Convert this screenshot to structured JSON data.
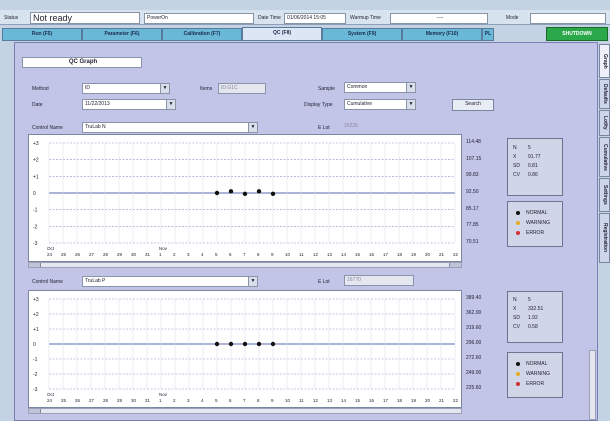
{
  "status_bar": {
    "status_label": "Status",
    "status_value": "Not ready",
    "power_label": "PowerOn",
    "datetime_label": "Date Time",
    "datetime_value": "01/06/2014 15:05",
    "warmup_label": "Warmup Time",
    "warmup_value": "----",
    "mode_label": "Mode",
    "mode_value": ""
  },
  "tabs": [
    {
      "label": "Run (F5)"
    },
    {
      "label": "Parameter (F6)"
    },
    {
      "label": "Calibration (F7)"
    },
    {
      "label": "QC (F8)"
    },
    {
      "label": "System (F9)"
    },
    {
      "label": "Memory (F10)"
    },
    {
      "label": "PL"
    }
  ],
  "shutdown_label": "SHUTDOWN",
  "panel": {
    "title": "QC Graph",
    "method_label": "Method",
    "method_value": "ID",
    "items_label": "Items",
    "items_value": "ID:G1C",
    "date_label": "Date",
    "date_value": "11/22/2013",
    "sample_label": "Sample",
    "sample_value": "Common",
    "display_type_label": "Display Type",
    "display_type_value": "Cumulative",
    "search_label": "Search",
    "control_name_label": "Control Name",
    "control_name_1": "TruLab N",
    "lot_label": "E Lot",
    "lot_value_1": "16225",
    "control_name_2": "TruLab P",
    "lot_value_2": "16770"
  },
  "side_tabs": [
    {
      "label": "Graph"
    },
    {
      "label": "Defaults"
    },
    {
      "label": "Lot/ty"
    },
    {
      "label": "Cumulative"
    },
    {
      "label": "Settings"
    },
    {
      "label": "Registration"
    }
  ],
  "legend": {
    "normal": "NORMAL",
    "warning": "WARNING",
    "error": "ERROR"
  },
  "colors": {
    "normal": "#111111",
    "warning": "#e0b020",
    "error": "#d03030",
    "shutdown_bg": "#2aa84a",
    "tab_bg": "#6ab8d8"
  },
  "chart_data": [
    {
      "type": "scatter",
      "y_axis_labels": [
        "+3",
        "+2",
        "+1",
        "0",
        "-1",
        "-2",
        "-3"
      ],
      "right_values": [
        "114.48",
        "107.15",
        "99.83",
        "92.50",
        "85.17",
        "77.85",
        "70.51"
      ],
      "x_month_labels": [
        "Oct",
        "Nov"
      ],
      "x_labels": [
        "24",
        "25",
        "26",
        "27",
        "28",
        "29",
        "30",
        "31",
        "1",
        "2",
        "3",
        "4",
        "5",
        "6",
        "7",
        "8",
        "9",
        "10",
        "11",
        "12",
        "13",
        "14",
        "15",
        "16",
        "17",
        "18",
        "19",
        "20",
        "21",
        "22"
      ],
      "points": [
        {
          "x": "5",
          "sd": 0
        },
        {
          "x": "6",
          "sd": 0.1
        },
        {
          "x": "7",
          "sd": -0.05
        },
        {
          "x": "8",
          "sd": 0.1
        },
        {
          "x": "9",
          "sd": -0.05
        }
      ],
      "stats": {
        "n_label": "N",
        "n": "5",
        "x_label": "X",
        "x": "91.77",
        "sd_label": "SD",
        "sd": "0.81",
        "cv_label": "CV",
        "cv": "0.86"
      }
    },
    {
      "type": "scatter",
      "y_axis_labels": [
        "+3",
        "+2",
        "+1",
        "0",
        "-1",
        "-2",
        "-3"
      ],
      "right_values": [
        "389.40",
        "362.00",
        "319.60",
        "296.00",
        "272.60",
        "249.00",
        "225.60"
      ],
      "x_month_labels": [
        "Oct",
        "Nov"
      ],
      "x_labels": [
        "24",
        "25",
        "26",
        "27",
        "28",
        "29",
        "30",
        "31",
        "1",
        "2",
        "3",
        "4",
        "5",
        "6",
        "7",
        "8",
        "9",
        "10",
        "11",
        "12",
        "13",
        "14",
        "15",
        "16",
        "17",
        "18",
        "19",
        "20",
        "21",
        "22"
      ],
      "points": [
        {
          "x": "5",
          "sd": 0
        },
        {
          "x": "6",
          "sd": 0
        },
        {
          "x": "7",
          "sd": 0
        },
        {
          "x": "8",
          "sd": 0
        },
        {
          "x": "9",
          "sd": 0
        }
      ],
      "stats": {
        "n_label": "N",
        "n": "5",
        "x_label": "X",
        "x": "332.51",
        "sd_label": "SD",
        "sd": "1.92",
        "cv_label": "CV",
        "cv": "0.58"
      }
    }
  ]
}
